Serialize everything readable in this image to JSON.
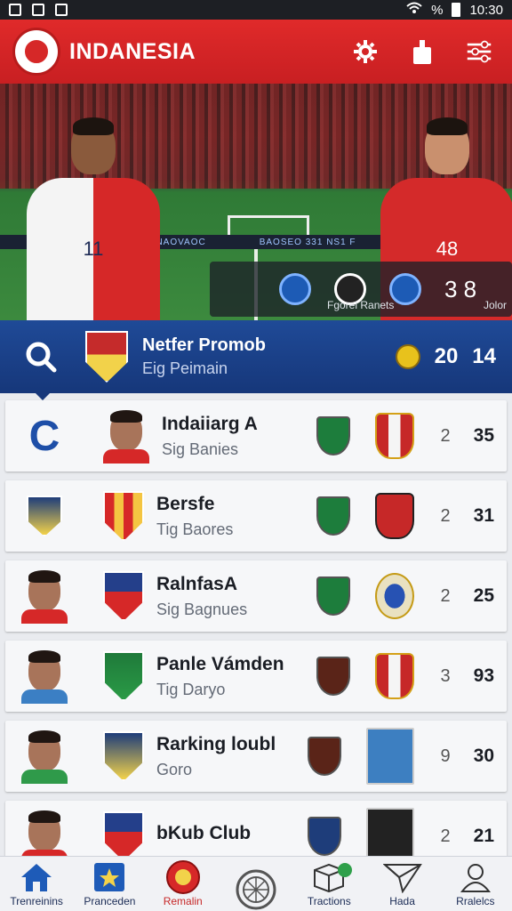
{
  "status_bar": {
    "time": "10:30",
    "battery_label": "%"
  },
  "app": {
    "title": "INDANESIA"
  },
  "hero": {
    "board_text": "BAOSEO 331 NS1 F",
    "board_left": "NAOVAOC",
    "player_left_number": "11",
    "player_right_number": "48",
    "score_label": "Fgorel Ranets",
    "score_value": "3 8",
    "score_sub": "Jolor"
  },
  "featured": {
    "title": "Netfer Promob",
    "subtitle": "Eig Peimain",
    "val1": "20",
    "val2": "14"
  },
  "rows": [
    {
      "lead": "C",
      "title": "Indaiiarg A",
      "subtitle": "Sig Banies",
      "n1": "2",
      "n2": "35"
    },
    {
      "title": "Bersfe",
      "subtitle": "Tig Baores",
      "n1": "2",
      "n2": "31"
    },
    {
      "title": "RalnfasA",
      "subtitle": "Sig Bagnues",
      "n1": "2",
      "n2": "25"
    },
    {
      "title": "Panle Vámden",
      "subtitle": "Tig Daryo",
      "n1": "3",
      "n2": "93"
    },
    {
      "title": "Rarking loubl",
      "subtitle": "Goro",
      "n1": "9",
      "n2": "30"
    },
    {
      "title": "bKub Club",
      "subtitle": "",
      "n1": "2",
      "n2": "21"
    }
  ],
  "nav": [
    {
      "label": "Trenreinins"
    },
    {
      "label": "Pranceden"
    },
    {
      "label": "Remalin"
    },
    {
      "label": ""
    },
    {
      "label": "Tractions"
    },
    {
      "label": "Hada"
    },
    {
      "label": "Rralelcs"
    }
  ],
  "colors": {
    "primary_red": "#d62828",
    "primary_blue": "#1f4a97"
  }
}
